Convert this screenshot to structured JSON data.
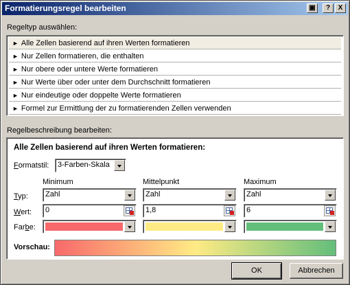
{
  "window": {
    "title": "Formatierungsregel bearbeiten",
    "restore_label": "▣",
    "help_label": "?",
    "close_label": "X"
  },
  "rule_type": {
    "label": "Regeltyp auswählen:",
    "items": [
      {
        "label": "Alle Zellen basierend auf ihren Werten formatieren",
        "selected": true
      },
      {
        "label": "Nur Zellen formatieren, die enthalten"
      },
      {
        "label": "Nur obere oder untere Werte formatieren"
      },
      {
        "label": "Nur Werte über oder unter dem Durchschnitt formatieren"
      },
      {
        "label": "Nur eindeutige oder doppelte Werte formatieren"
      },
      {
        "label": "Formel zur Ermittlung der zu formatierenden Zellen verwenden"
      }
    ]
  },
  "description": {
    "label": "Regelbeschreibung bearbeiten:",
    "heading": "Alle Zellen basierend auf ihren Werten formatieren:",
    "format_style": {
      "label_u": "F",
      "label_rest": "ormatstil:",
      "value": "3-Farben-Skala"
    },
    "columns": [
      {
        "header": "Minimum",
        "type": "Zahl",
        "value": "0",
        "color": "#f8696b"
      },
      {
        "header": "Mittelpunkt",
        "type": "Zahl",
        "value": "1,8",
        "color": "#ffeb84"
      },
      {
        "header": "Maximum",
        "type": "Zahl",
        "value": "6",
        "color": "#63be7b"
      }
    ],
    "row_labels": {
      "type": {
        "u": "T",
        "rest": "yp:"
      },
      "value": {
        "u": "W",
        "rest": "ert:"
      },
      "color": {
        "pre": "Far",
        "u": "b",
        "rest": "e:"
      }
    },
    "preview_label": "Vorschau:",
    "preview_colors": [
      "#f8696b",
      "#ffeb84",
      "#63be7b"
    ]
  },
  "buttons": {
    "ok": "OK",
    "cancel": "Abbrechen"
  }
}
